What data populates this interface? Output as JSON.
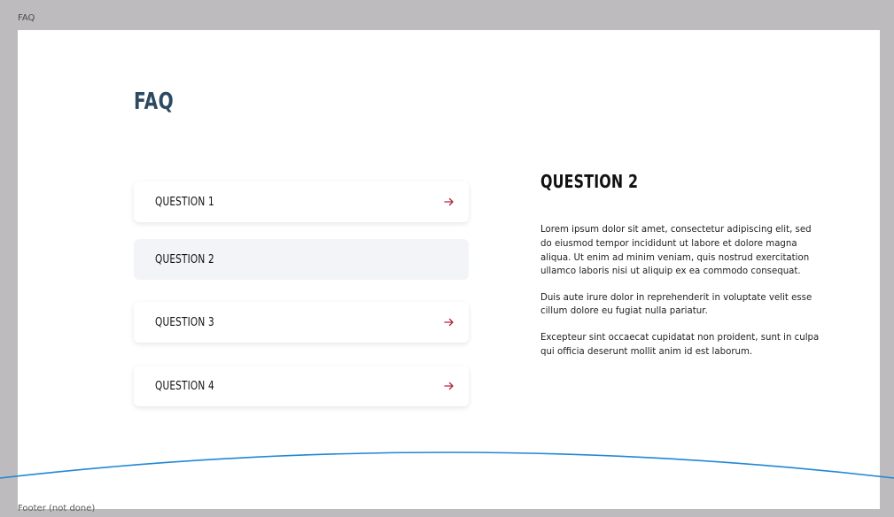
{
  "frame": {
    "top_label": "FAQ",
    "bottom_label": "Footer (not done)"
  },
  "page": {
    "title": "FAQ"
  },
  "questions": [
    {
      "label": "QUESTION 1",
      "active": false
    },
    {
      "label": "QUESTION 2",
      "active": true
    },
    {
      "label": "QUESTION 3",
      "active": false
    },
    {
      "label": "QUESTION 4",
      "active": false
    }
  ],
  "answer": {
    "title": "QUESTION 2",
    "paragraphs": [
      "Lorem ipsum dolor sit amet, consectetur adipiscing elit, sed do eiusmod tempor incididunt ut labore et dolore magna aliqua. Ut enim ad minim veniam, quis nostrud exercitation ullamco laboris nisi ut aliquip ex ea commodo consequat.",
      "Duis aute irure dolor in reprehenderit in voluptate velit esse cillum dolore eu fugiat nulla pariatur.",
      "Excepteur sint occaecat cupidatat non proident, sunt in culpa qui officia deserunt mollit anim id est laborum."
    ]
  },
  "colors": {
    "frame_background": "#bdbbbd",
    "title_color": "#2d4a63",
    "arrow_color": "#b0243a",
    "active_item_bg": "#f2f4f8",
    "footer_curve": "#1f87d6"
  },
  "icons": {
    "question_arrow": "arrow-right-icon"
  }
}
